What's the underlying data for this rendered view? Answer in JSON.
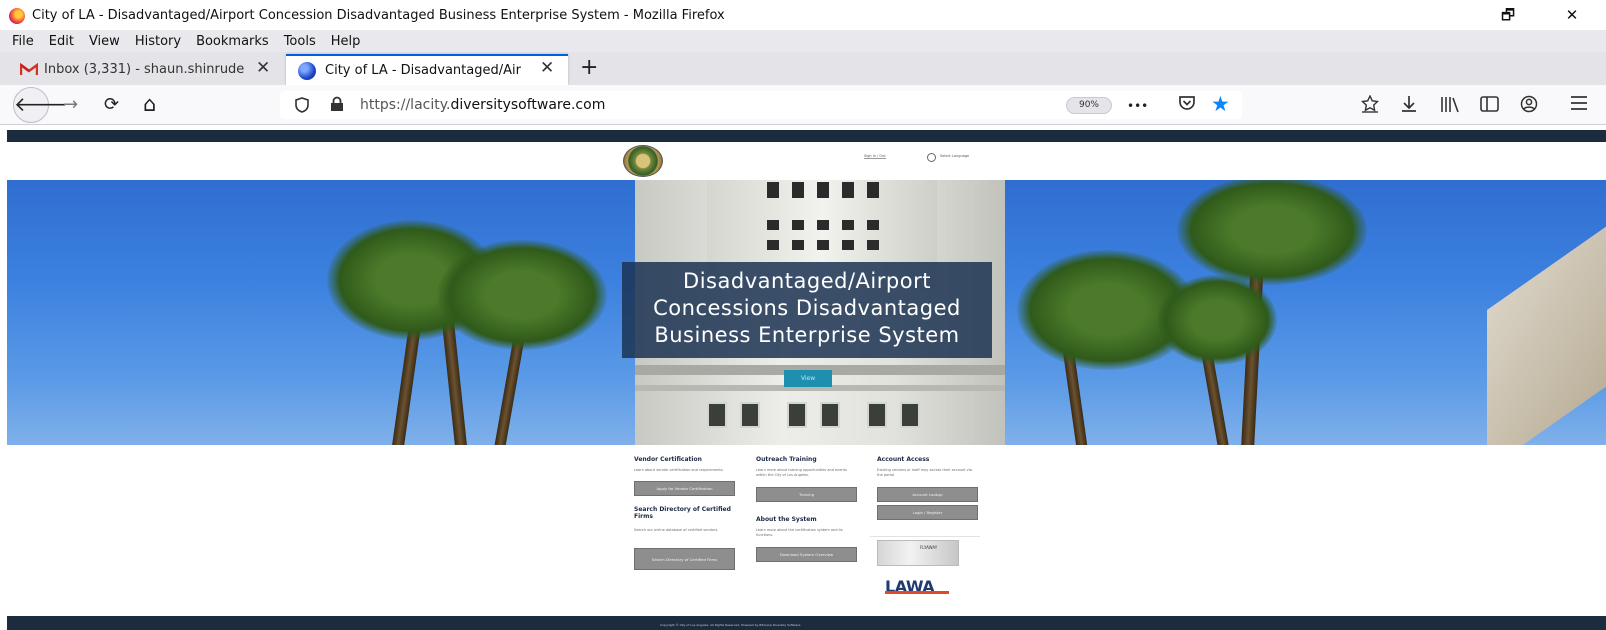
{
  "window": {
    "title": "City of LA - Disadvantaged/Airport Concession Disadvantaged Business Enterprise System - Mozilla Firefox",
    "restore_glyph": "🗗",
    "close_glyph": "✕"
  },
  "menu": [
    "File",
    "Edit",
    "View",
    "History",
    "Bookmarks",
    "Tools",
    "Help"
  ],
  "tabs": [
    {
      "label": "Inbox (3,331) - shaun.shinrude",
      "icon": "gmail-icon",
      "active": false
    },
    {
      "label": "City of LA - Disadvantaged/Air",
      "icon": "globe-icon",
      "active": true
    }
  ],
  "toolbar": {
    "back": "🡐",
    "forward": "→",
    "reload": "⟳",
    "home": "⌂",
    "url_prefix": "https://lacity.",
    "url_domain": "diversitysoftware.com",
    "zoom": "90%",
    "more": "•••",
    "icons": [
      "pocket-icon",
      "bookmark-star-icon",
      "ext-icon",
      "download-icon",
      "library-icon",
      "sidebar-icon",
      "account-icon",
      "menu-icon"
    ]
  },
  "site": {
    "header_links": [
      "Sign In / Out",
      "Select Language"
    ],
    "hero": {
      "title_lines": [
        "Disadvantaged/Airport",
        "Concessions Disadvantaged",
        "Business Enterprise System"
      ],
      "button": "View"
    },
    "columns": [
      {
        "heading": "Vendor Certification",
        "text": "Learn about vendor certification and requirements.",
        "button": "Apply for Vendor Certification"
      },
      {
        "heading": "Outreach Training",
        "text": "Learn more about training opportunities and events within the City of Los Angeles.",
        "button": "Training"
      },
      {
        "heading": "Account Access",
        "text": "Existing vendors or staff may access their account via the portal.",
        "buttons": [
          "Account Lookup",
          "Login / Register"
        ]
      },
      {
        "heading": "Search Directory of Certified Firms",
        "text": "Search our online database of certified vendors.",
        "button": "Search Directory of Certified Firms"
      },
      {
        "heading": "About the System",
        "text": "Learn more about the certification system and its functions.",
        "button": "Download System Overview"
      }
    ],
    "partner_logo_text": "FLYAWAY",
    "lawa_logo": "LAWA",
    "footer": "Copyright © City of Los Angeles. All Rights Reserved. Powered by B2Gnow Diversity Software."
  },
  "colors": {
    "accent": "#0060df",
    "navy": "#1c2c3f",
    "hero_title_bg": "#1c3252",
    "hero_button": "#1f8fb0"
  }
}
